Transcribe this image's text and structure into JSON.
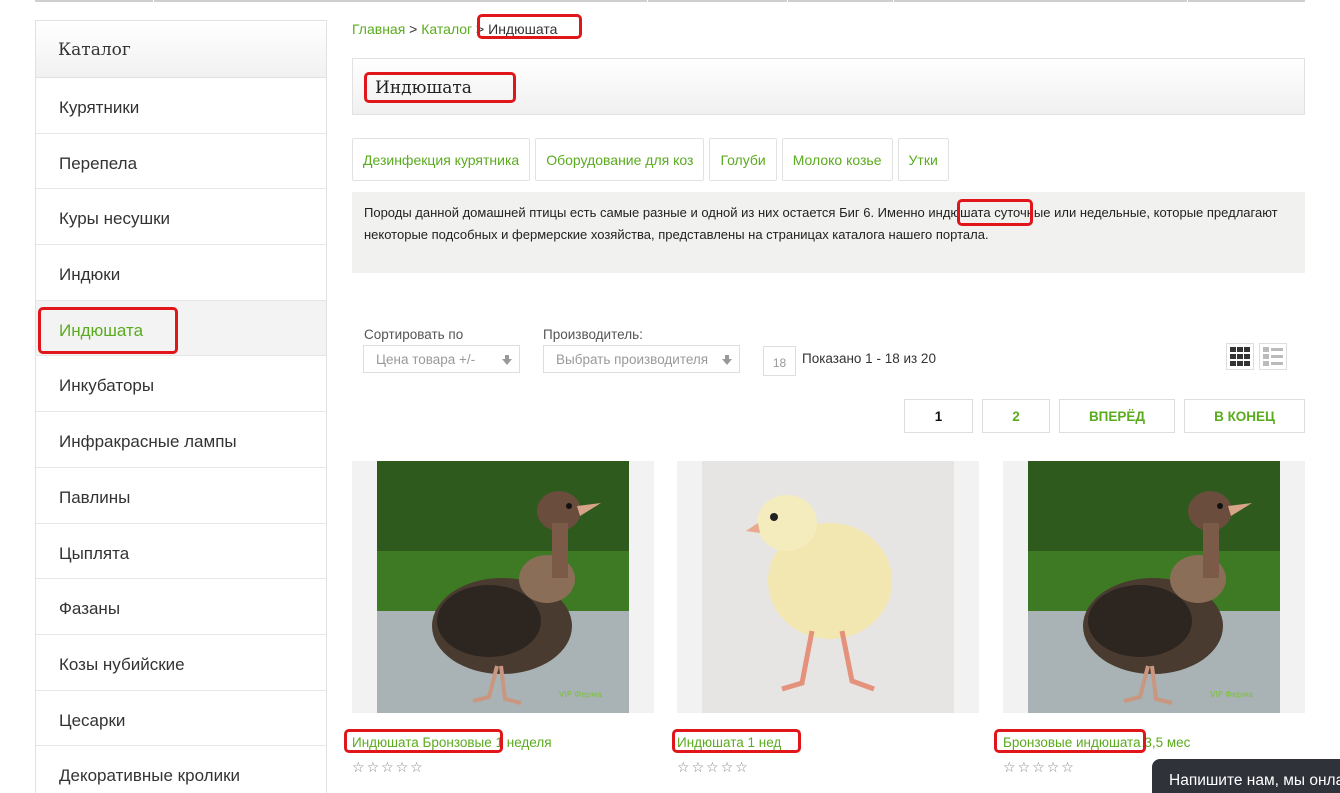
{
  "sidebar": {
    "title": "Каталог",
    "items": [
      {
        "label": "Курятники"
      },
      {
        "label": "Перепела"
      },
      {
        "label": "Куры несушки"
      },
      {
        "label": "Индюки"
      },
      {
        "label": "Индюшата"
      },
      {
        "label": "Инкубаторы"
      },
      {
        "label": "Инфракрасные лампы"
      },
      {
        "label": "Павлины"
      },
      {
        "label": "Цыплята"
      },
      {
        "label": "Фазаны"
      },
      {
        "label": "Козы нубийские"
      },
      {
        "label": "Цесарки"
      },
      {
        "label": "Декоративные кролики"
      }
    ],
    "active_index": 4
  },
  "breadcrumb": {
    "home": "Главная",
    "sep1": " > ",
    "catalog": "Каталог",
    "sep2": " > ",
    "current": "Индюшата"
  },
  "page_title": "Индюшата",
  "tags": [
    "Дезинфекция курятника",
    "Оборудование для коз",
    "Голуби",
    "Молоко козье",
    "Утки"
  ],
  "description": {
    "before": "Породы данной домашней птицы есть самые разные и одной из них остается Биг 6. Именно ",
    "highlight": "индюшата",
    "after": " суточные или недельные, которые предлагают некоторые подсобных и фермерские хозяйства, представлены на страницах каталога нашего портала."
  },
  "sort": {
    "label": "Сортировать по",
    "value": "Цена товара +/-"
  },
  "maker": {
    "label": "Производитель:",
    "value": "Выбрать производителя"
  },
  "per_page": "18",
  "shown_text": "Показано 1 - 18 из 20",
  "pagination": [
    {
      "label": "1",
      "current": true
    },
    {
      "label": "2",
      "current": false
    },
    {
      "label": "ВПЕРЁД",
      "current": false
    },
    {
      "label": "В КОНЕЦ",
      "current": false
    }
  ],
  "products": [
    {
      "name": "Индюшата Бронзовые 1 неделя",
      "rating": 0,
      "image": "bronze-poult-photo",
      "watermark": "VIP Ферма"
    },
    {
      "name": "Индюшата 1 нед",
      "rating": 0,
      "image": "yellow-poult-photo",
      "watermark": ""
    },
    {
      "name": "Бронзовые индюшата 3,5 мес",
      "rating": 0,
      "image": "bronze-poult-photo",
      "watermark": "VIP Ферма"
    }
  ],
  "chat_text": "Напишите нам, мы онлайн",
  "colors": {
    "accent": "#5aab1e",
    "highlight": "#e0161b",
    "chat_bg": "#2f3239"
  }
}
